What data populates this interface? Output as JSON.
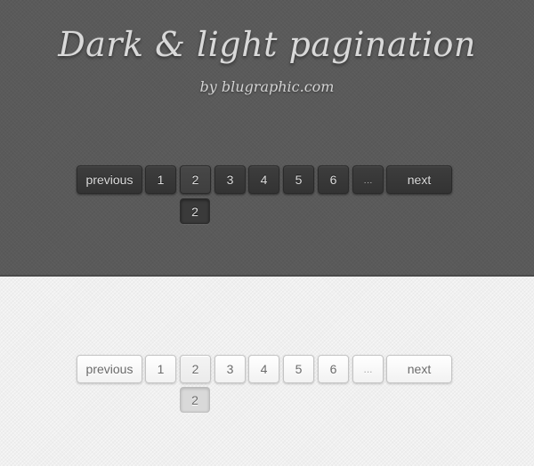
{
  "header": {
    "title": "Dark & light pagination",
    "subtitle": "by blugraphic.com"
  },
  "dark_pagination": {
    "previous_label": "previous",
    "pages": [
      "1",
      "2",
      "3",
      "4",
      "5",
      "6"
    ],
    "ellipsis": "...",
    "next_label": "next",
    "current_page": "2",
    "active_state_label": "2"
  },
  "light_pagination": {
    "previous_label": "previous",
    "pages": [
      "1",
      "2",
      "3",
      "4",
      "5",
      "6"
    ],
    "ellipsis": "...",
    "next_label": "next",
    "current_page": "2",
    "active_state_label": "2"
  },
  "colors": {
    "dark_background": "#5a5a5a",
    "dark_button": "#363636",
    "light_background": "#efefef",
    "light_button": "#f8f8f8",
    "light_active": "#d9d9d9"
  }
}
